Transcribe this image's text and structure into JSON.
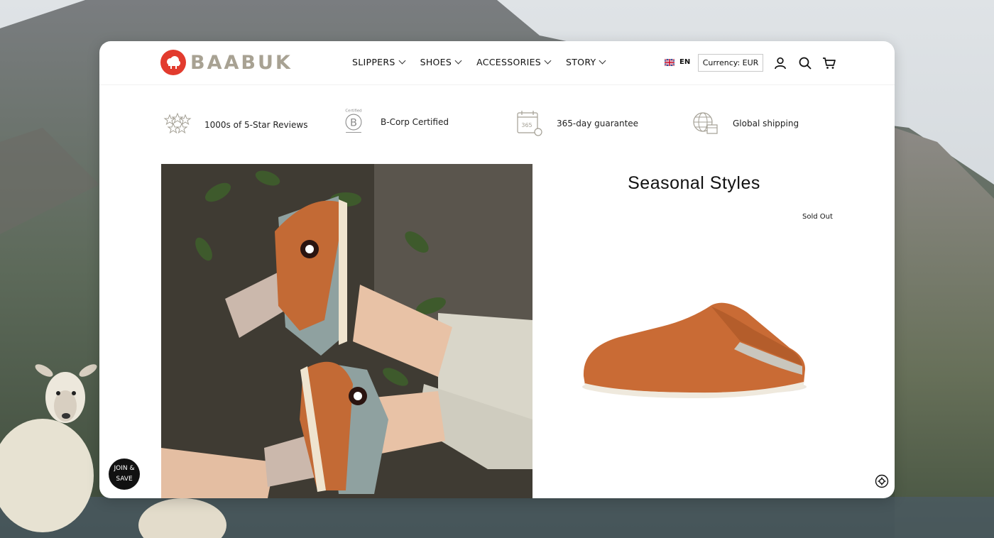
{
  "brand": {
    "name": "BAABUK",
    "logo_icon": "sheep-cloud-icon",
    "accent": "#e23b2e"
  },
  "nav": {
    "items": [
      {
        "label": "SLIPPERS"
      },
      {
        "label": "SHOES"
      },
      {
        "label": "ACCESSORIES"
      },
      {
        "label": "STORY"
      }
    ]
  },
  "header": {
    "language": "EN",
    "language_icon": "uk-flag-icon",
    "currency_label": "Currency: EUR",
    "icons": [
      "account-icon",
      "search-icon",
      "cart-icon"
    ]
  },
  "features": [
    {
      "label": "1000s of 5-Star Reviews",
      "icon": "stars-icon"
    },
    {
      "label": "B-Corp Certified",
      "icon": "bcorp-icon",
      "icon_text": "Certified"
    },
    {
      "label": "365-day guarantee",
      "icon": "calendar-365-icon",
      "icon_text": "365"
    },
    {
      "label": "Global shipping",
      "icon": "globe-shipping-icon"
    }
  ],
  "seasonal": {
    "title": "Seasonal Styles",
    "badge": "Sold Out"
  },
  "popup": {
    "line1": "JOIN &",
    "line2": "SAVE"
  }
}
